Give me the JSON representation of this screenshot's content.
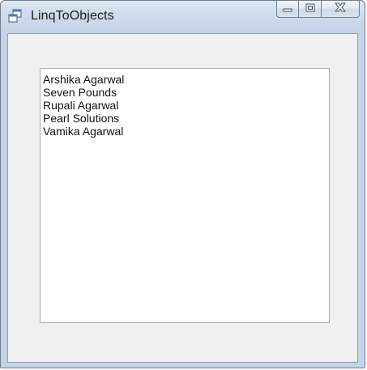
{
  "window": {
    "title": "LinqToObjects",
    "icon": "windows-form-icon"
  },
  "caption_buttons": {
    "minimize_icon": "minimize-icon",
    "maximize_icon": "maximize-icon",
    "close_icon": "close-icon"
  },
  "listbox": {
    "items": [
      "Arshika Agarwal",
      "Seven Pounds",
      "Rupali Agarwal",
      "Pearl Solutions",
      "Vamika Agarwal"
    ]
  },
  "colors": {
    "client_background": "#f0f0f0",
    "listbox_background": "#ffffff",
    "listbox_border": "#abadb3"
  }
}
